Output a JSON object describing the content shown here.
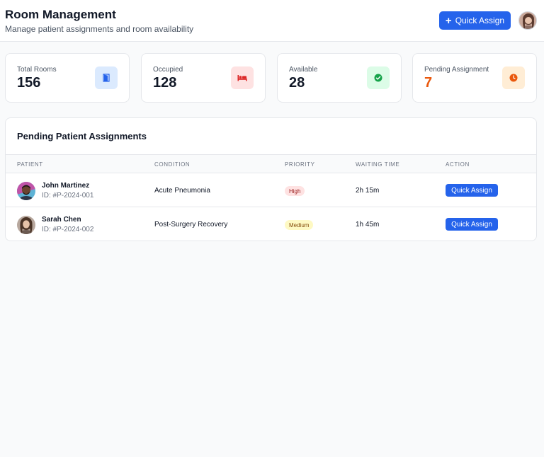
{
  "header": {
    "title": "Room Management",
    "subtitle": "Manage patient assignments and room availability",
    "quick_assign_label": "Quick Assign"
  },
  "stats": [
    {
      "label": "Total Rooms",
      "value": "156",
      "icon": "door-icon",
      "color": "#2563eb",
      "bg": "#dbeafe"
    },
    {
      "label": "Occupied",
      "value": "128",
      "icon": "bed-icon",
      "color": "#dc2626",
      "bg": "#fee2e2"
    },
    {
      "label": "Available",
      "value": "28",
      "icon": "check-circle-icon",
      "color": "#16a34a",
      "bg": "#dcfce7"
    },
    {
      "label": "Pending Assignment",
      "value": "7",
      "icon": "clock-icon",
      "color": "#ea580c",
      "bg": "#ffedd5"
    }
  ],
  "table": {
    "title": "Pending Patient Assignments",
    "columns": [
      "PATIENT",
      "CONDITION",
      "PRIORITY",
      "WAITING TIME",
      "ACTION"
    ],
    "rows": [
      {
        "name": "John Martinez",
        "id": "ID: #P-2024-001",
        "condition": "Acute Pneumonia",
        "priority": "High",
        "waiting": "2h 15m",
        "action": "Quick Assign"
      },
      {
        "name": "Sarah Chen",
        "id": "ID: #P-2024-002",
        "condition": "Post-Surgery Recovery",
        "priority": "Medium",
        "waiting": "1h 45m",
        "action": "Quick Assign"
      }
    ]
  },
  "colors": {
    "primary": "#2563eb",
    "pending_value": "#ea580c"
  }
}
